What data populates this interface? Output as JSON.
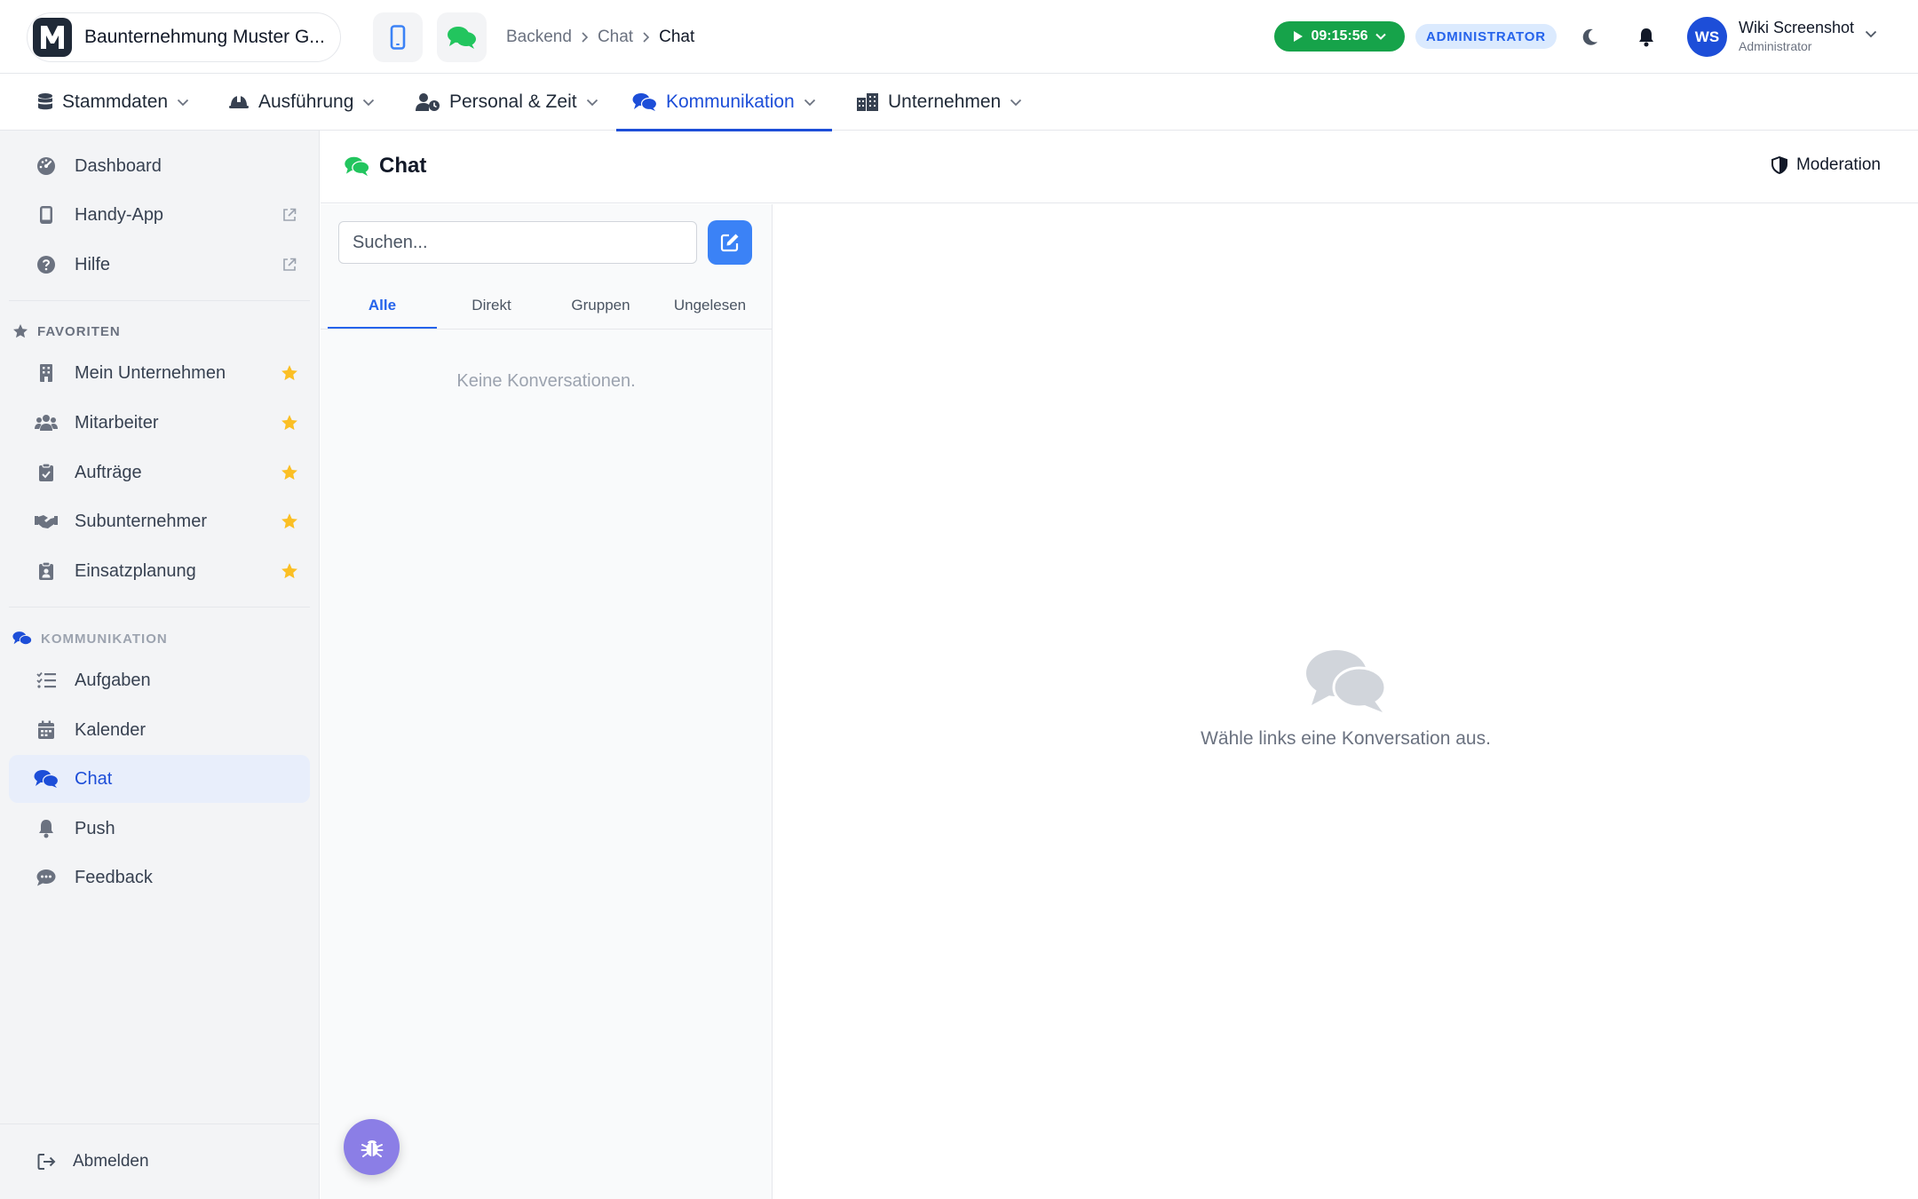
{
  "app": {
    "company_name": "Baunternehmung Muster G...",
    "logo_letter": "M",
    "icons": {
      "mobile": "mobile-phone-icon",
      "chat": "chat-bubbles-icon"
    }
  },
  "breadcrumb": [
    "Backend",
    "Chat",
    "Chat"
  ],
  "header": {
    "timer": "09:15:56",
    "role_badge": "ADMINISTRATOR",
    "user_initials": "WS",
    "user_name": "Wiki Screenshot",
    "user_role": "Administrator"
  },
  "nav": {
    "items": [
      {
        "label": "Stammdaten",
        "icon": "database-icon"
      },
      {
        "label": "Ausführung",
        "icon": "hardhat-icon"
      },
      {
        "label": "Personal & Zeit",
        "icon": "user-clock-icon"
      },
      {
        "label": "Kommunikation",
        "icon": "chat-bubbles-icon",
        "active": true
      },
      {
        "label": "Unternehmen",
        "icon": "city-icon"
      }
    ]
  },
  "sidebar": {
    "top": [
      {
        "label": "Dashboard",
        "icon": "gauge-icon"
      },
      {
        "label": "Handy-App",
        "icon": "mobile-phone-icon",
        "external": true
      },
      {
        "label": "Hilfe",
        "icon": "question-circle-icon",
        "external": true
      }
    ],
    "favorites_title": "FAVORITEN",
    "favorites": [
      {
        "label": "Mein Unternehmen",
        "icon": "building-icon"
      },
      {
        "label": "Mitarbeiter",
        "icon": "users-icon"
      },
      {
        "label": "Aufträge",
        "icon": "clipboard-check-icon"
      },
      {
        "label": "Subunternehmer",
        "icon": "handshake-icon"
      },
      {
        "label": "Einsatzplanung",
        "icon": "clipboard-user-icon"
      }
    ],
    "kommunikation_title": "KOMMUNIKATION",
    "kommunikation": [
      {
        "label": "Aufgaben",
        "icon": "list-check-icon"
      },
      {
        "label": "Kalender",
        "icon": "calendar-icon"
      },
      {
        "label": "Chat",
        "icon": "chat-bubbles-icon",
        "active": true
      },
      {
        "label": "Push",
        "icon": "bell-icon"
      },
      {
        "label": "Feedback",
        "icon": "comment-dots-icon"
      }
    ],
    "logout": "Abmelden"
  },
  "page": {
    "title": "Chat",
    "moderation": "Moderation",
    "search_placeholder": "Suchen...",
    "tabs": [
      "Alle",
      "Direkt",
      "Gruppen",
      "Ungelesen"
    ],
    "active_tab": "Alle",
    "empty_conversations": "Keine Konversationen.",
    "empty_detail": "Wähle links eine Konversation aus."
  },
  "colors": {
    "accent": "#1d4ed8",
    "primary_button": "#3b82f6",
    "timer_green": "#16a34a",
    "favorite_star": "#fbbf24",
    "chat_green": "#22c55e",
    "bug_fab": "#8b7ee6"
  }
}
